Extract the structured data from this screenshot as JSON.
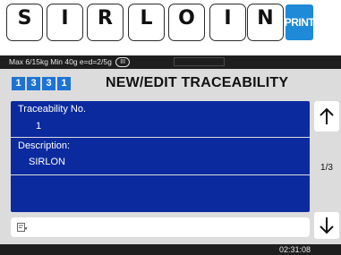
{
  "keys": [
    "S",
    "I",
    "R",
    "L",
    "O",
    "I",
    "N"
  ],
  "print_label": "PRINT",
  "status": {
    "spec": "Max 6/15kg Min 40g e=d=2/5g",
    "range": "III"
  },
  "mode_digits": [
    "1",
    "3",
    "3",
    "1"
  ],
  "title": "NEW/EDIT TRACEABILITY",
  "fields": {
    "traceability_no": {
      "label": "Traceability No.",
      "value": "1"
    },
    "description": {
      "label": "Description:",
      "value": "SIRLON"
    }
  },
  "input": {
    "value": ""
  },
  "page_indicator": "1/3",
  "clock": "02:31:08",
  "colors": {
    "panel": "#0a2a9e",
    "accent": "#1e73d4",
    "print_key": "#1e8ad8",
    "background": "#dcdcdc"
  },
  "icons": {
    "input": "edit-icon",
    "up": "arrow-up-icon",
    "down": "arrow-down-icon"
  }
}
